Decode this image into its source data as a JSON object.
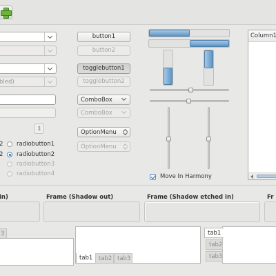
{
  "toolbar": {
    "add_icon": "add-icon"
  },
  "left": {
    "combo_disabled_text": "bled)",
    "spin_value": "1",
    "radios": [
      {
        "label": "radiobutton1",
        "selected": false,
        "disabled": false
      },
      {
        "label": "radiobutton2",
        "selected": true,
        "disabled": false
      },
      {
        "label": "radiobutton3",
        "selected": false,
        "disabled": true
      },
      {
        "label": "radiobutton4",
        "selected": false,
        "disabled": true
      }
    ],
    "radio_partial": [
      "2"
    ]
  },
  "middle": {
    "button1": "button1",
    "button2": "button2",
    "togglebutton1": "togglebutton1",
    "togglebutton2": "togglebutton2",
    "combobox1": "ComboBox",
    "combobox2": "ComboBox",
    "optionmenu1": "OptionMenu",
    "optionmenu2": "OptionMenu"
  },
  "right": {
    "move_in_harmony": "Move In Harmony",
    "move_in_harmony_checked": true,
    "tree_column": "Column1"
  },
  "frames": {
    "frame_partial": "in)",
    "frame_shadow_out": "Frame (Shadow out)",
    "frame_shadow_etched_in": "Frame (Shadow etched in)",
    "frame_partial_right": "Fr"
  },
  "notebooks": {
    "nb1_tab": "3",
    "nb2_tabs": [
      "tab1",
      "tab2",
      "tab3"
    ],
    "nb3_tabs": [
      "tab1",
      "tab2",
      "tab3"
    ]
  }
}
